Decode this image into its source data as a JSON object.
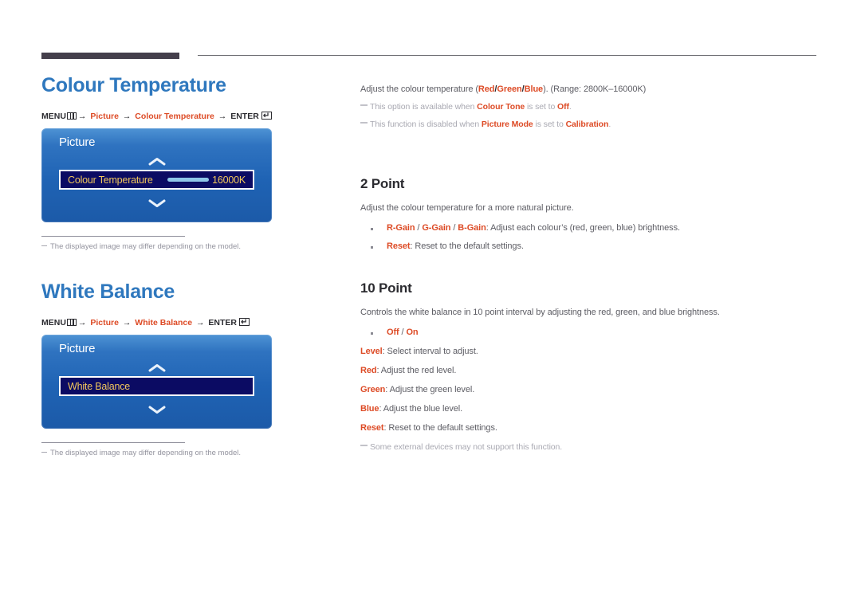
{
  "page": {
    "accent_blue": "#2f78be",
    "accent_orange": "#dd4b26",
    "osd_highlight_text": "#f2c75c"
  },
  "left_column": {
    "section1": {
      "title": "Colour Temperature",
      "menu_path": {
        "menu_label": "MENU",
        "arrow": "→",
        "step1": "Picture",
        "step2": "Colour Temperature",
        "enter_label": "ENTER",
        "enter_glyph": "↵"
      },
      "osd": {
        "title": "Picture",
        "row_label": "Colour Temperature",
        "row_value": "16000K",
        "chevron_up": "chevron-up-icon",
        "chevron_down": "chevron-down-icon"
      },
      "note": "The displayed image may differ depending on the model."
    },
    "section2": {
      "title": "White Balance",
      "menu_path": {
        "menu_label": "MENU",
        "arrow": "→",
        "step1": "Picture",
        "step2": "White Balance",
        "enter_label": "ENTER",
        "enter_glyph": "↵"
      },
      "osd": {
        "title": "Picture",
        "row_label": "White Balance",
        "row_value": "",
        "chevron_up": "chevron-up-icon",
        "chevron_down": "chevron-down-icon"
      },
      "note": "The displayed image may differ depending on the model."
    }
  },
  "right_column": {
    "intro": {
      "lead_pre": "Adjust the colour temperature (",
      "lead_red": "Red",
      "sep1": "/",
      "lead_green": "Green",
      "sep2": "/",
      "lead_blue": "Blue",
      "lead_post": "). (Range: 2800K–16000K)",
      "note1_pre": "This option is available when ",
      "note1_term": "Colour Tone",
      "note1_mid": " is set to ",
      "note1_value": "Off",
      "note1_post": ".",
      "note2_pre": "This function is disabled when ",
      "note2_term": "Picture Mode",
      "note2_mid": " is set to ",
      "note2_value": "Calibration",
      "note2_post": "."
    },
    "two_point": {
      "title": "2 Point",
      "description": "Adjust the colour temperature for a more natural picture.",
      "bullets": [
        {
          "term_r": "R-Gain",
          "sep1": " / ",
          "term_g": "G-Gain",
          "sep2": " / ",
          "term_b": "B-Gain",
          "text": ": Adjust each colour’s (red, green, blue) brightness."
        },
        {
          "term": "Reset",
          "text": ": Reset to the default settings."
        }
      ]
    },
    "ten_point": {
      "title": "10 Point",
      "description": "Controls the white balance in 10 point interval by adjusting the red, green, and blue brightness.",
      "toggle": {
        "off": "Off",
        "sep": " / ",
        "on": "On"
      },
      "items": [
        {
          "term": "Level",
          "text": ": Select interval to adjust."
        },
        {
          "term": "Red",
          "text": ": Adjust the red level."
        },
        {
          "term": "Green",
          "text": ": Adjust the green level."
        },
        {
          "term": "Blue",
          "text": ": Adjust the blue level."
        },
        {
          "term": "Reset",
          "text": ": Reset to the default settings."
        }
      ],
      "footnote": "Some external devices may not support this function."
    }
  }
}
